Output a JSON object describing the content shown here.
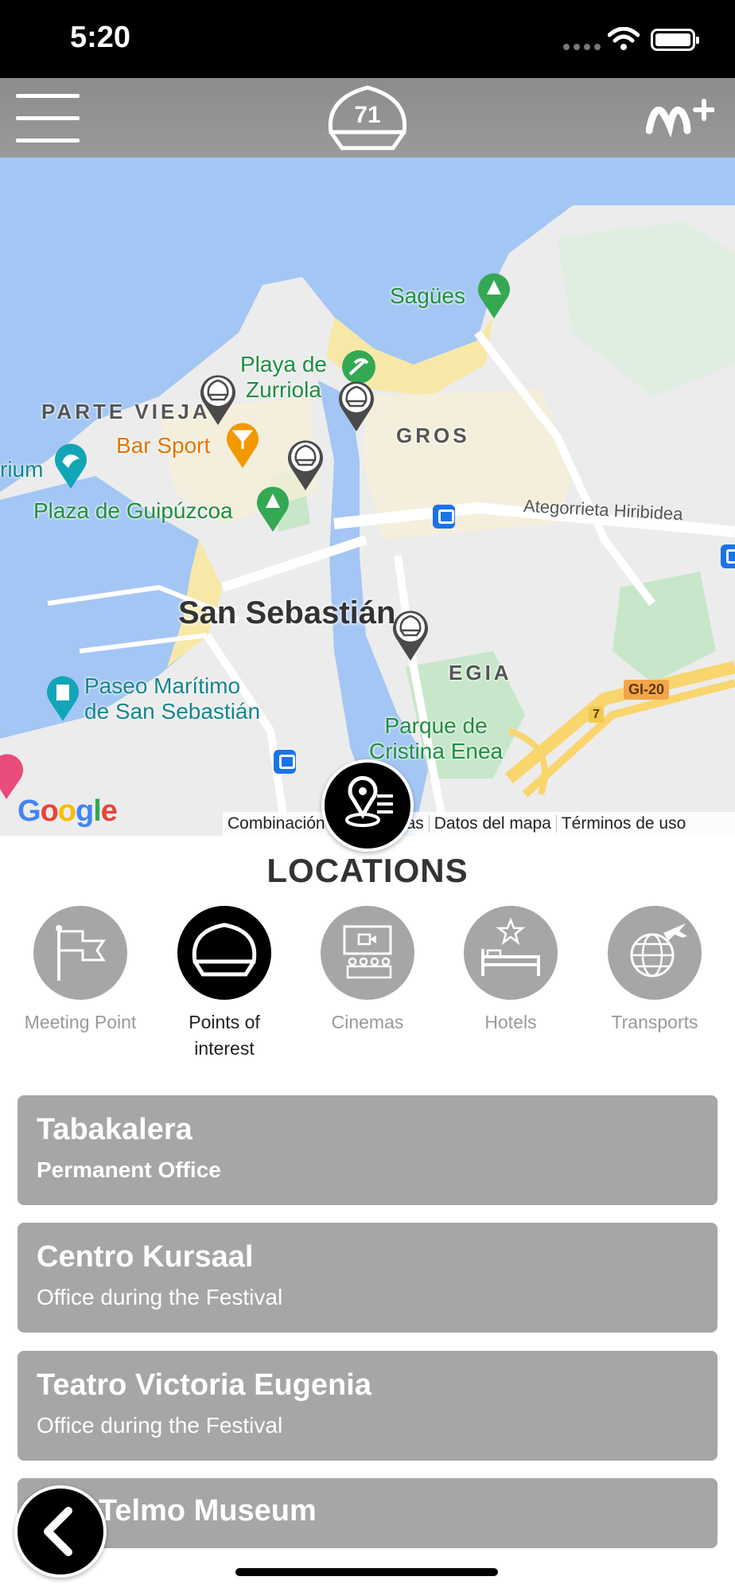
{
  "status_bar": {
    "time": "5:20"
  },
  "header": {
    "festival_number": "71",
    "menu_icon": "hamburger-icon",
    "brand_logo": "movistar-plus-logo"
  },
  "map": {
    "labels": {
      "sagues": "Sagües",
      "playa_zurriola": "Playa de\nZurriola",
      "parte_vieja": "PARTE VIEJA",
      "bar_sport": "Bar Sport",
      "gros": "GROS",
      "aquarium": "rium",
      "plaza_guipuzcoa": "Plaza de Guipúzcoa",
      "ategorrieta": "Ategorrieta Hiribidea",
      "city": "San Sebastián",
      "egia": "EGIA",
      "paseo_maritimo": "Paseo Marítimo\nde San Sebastián",
      "parque_cristina": "Parque de\nCristina Enea",
      "road_gi20": "GI-20",
      "road_7": "7"
    },
    "google_logo": "Google",
    "footer": {
      "combination": "Combinación",
      "keys": "as",
      "map_data": "Datos del mapa",
      "terms": "Términos de uso"
    },
    "colors": {
      "water": "#a4c6f4",
      "land": "#ececec",
      "park": "#c8e6c9",
      "road_major": "#f9d56e"
    }
  },
  "locations": {
    "title": "LOCATIONS",
    "categories": [
      {
        "label": "Meeting Point",
        "icon": "flag-icon",
        "active": false
      },
      {
        "label": "Points of\ninterest",
        "icon": "shell-icon",
        "active": true
      },
      {
        "label": "Cinemas",
        "icon": "cinema-icon",
        "active": false
      },
      {
        "label": "Hotels",
        "icon": "bed-icon",
        "active": false
      },
      {
        "label": "Transports",
        "icon": "globe-plane-icon",
        "active": false
      }
    ],
    "items": [
      {
        "name": "Tabakalera",
        "subtitle": "Permanent Office"
      },
      {
        "name": "Centro Kursaal",
        "subtitle": "Office during the Festival"
      },
      {
        "name": "Teatro Victoria Eugenia",
        "subtitle": "Office during the Festival"
      },
      {
        "name": "Telmo Museum",
        "subtitle": ""
      }
    ]
  }
}
